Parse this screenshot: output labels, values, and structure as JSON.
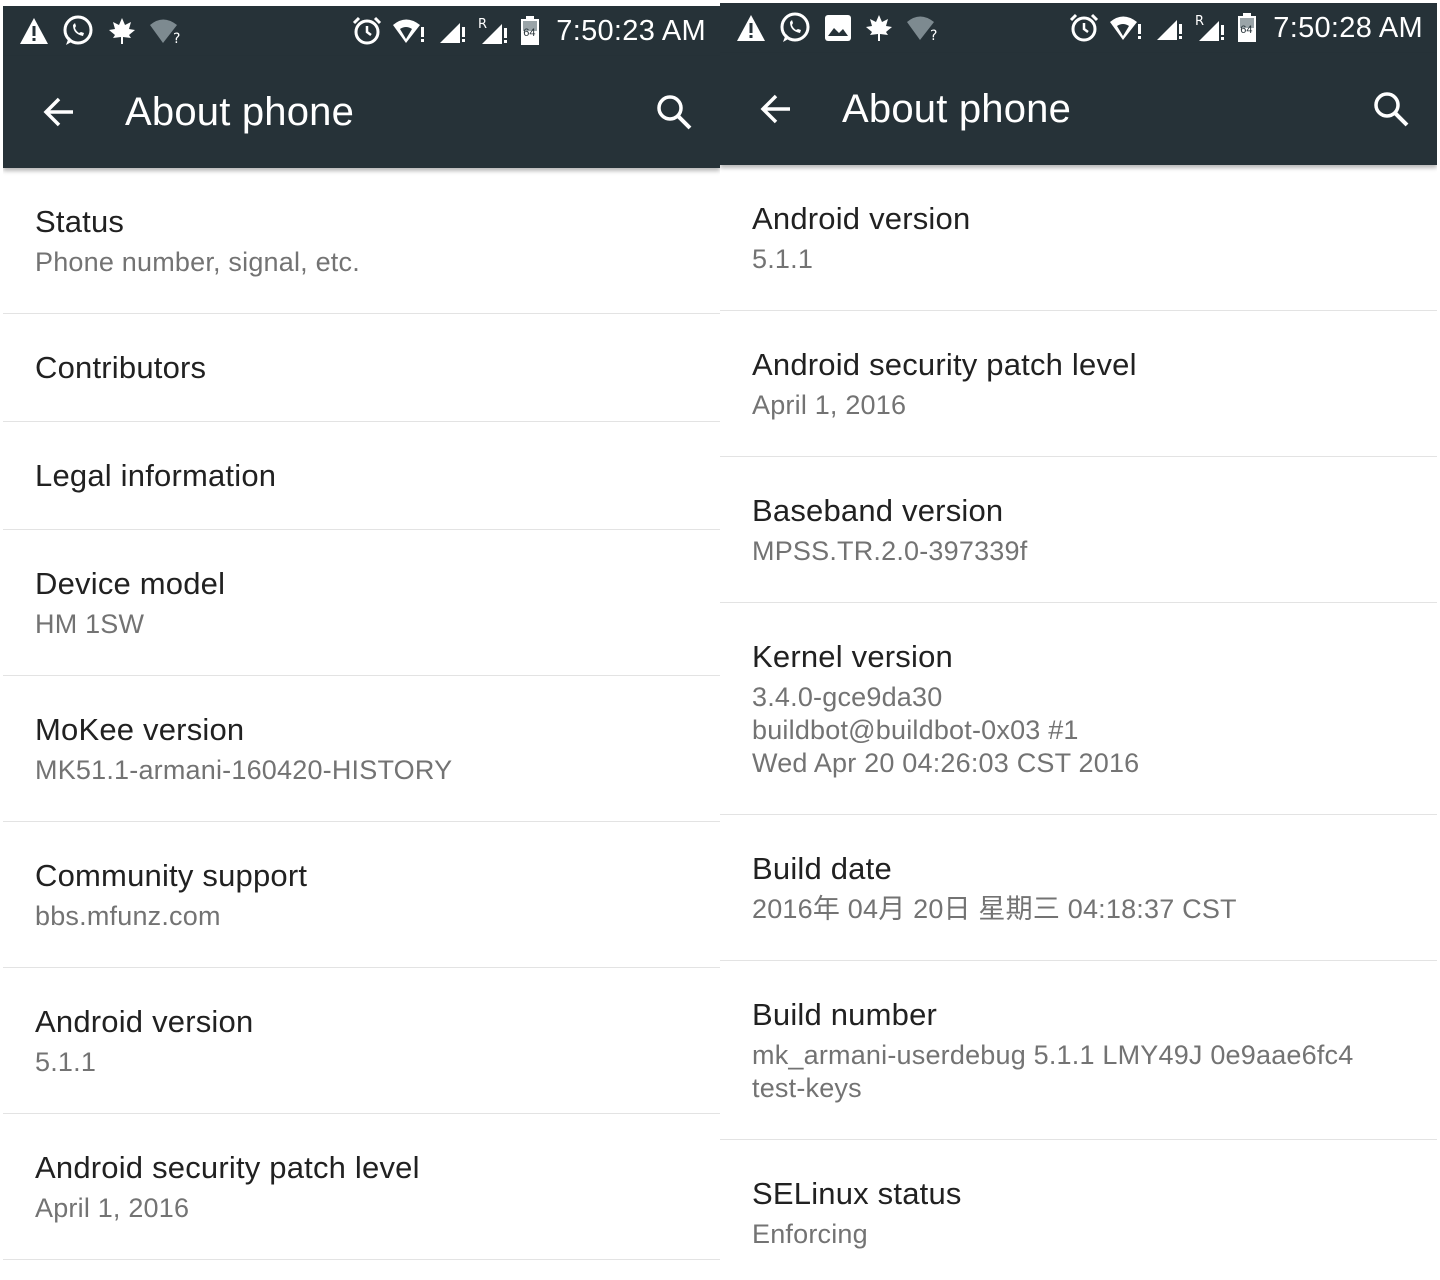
{
  "left": {
    "status_bar": {
      "time": "7:50:23 AM",
      "left_icons": [
        "warning-icon",
        "whatsapp-icon",
        "leaf-icon",
        "wifi-unknown-icon"
      ],
      "right_icons": [
        "alarm-icon",
        "wifi-alert-icon",
        "signal-icon",
        "signal-roaming-icon",
        "battery-icon"
      ],
      "battery_label": "64"
    },
    "app_bar": {
      "title": "About phone"
    },
    "items": [
      {
        "title": "Status",
        "summary": "Phone number, signal, etc."
      },
      {
        "title": "Contributors"
      },
      {
        "title": "Legal information"
      },
      {
        "title": "Device model",
        "summary": "HM 1SW"
      },
      {
        "title": "MoKee version",
        "summary": "MK51.1-armani-160420-HISTORY"
      },
      {
        "title": "Community support",
        "summary": "bbs.mfunz.com"
      },
      {
        "title": "Android version",
        "summary": "5.1.1"
      },
      {
        "title": "Android security patch level",
        "summary": "April 1, 2016"
      }
    ]
  },
  "right": {
    "status_bar": {
      "time": "7:50:28 AM",
      "left_icons": [
        "warning-icon",
        "whatsapp-icon",
        "image-icon",
        "leaf-icon",
        "wifi-unknown-icon"
      ],
      "right_icons": [
        "alarm-icon",
        "wifi-alert-icon",
        "signal-icon",
        "signal-roaming-icon",
        "battery-icon"
      ],
      "battery_label": "64"
    },
    "app_bar": {
      "title": "About phone"
    },
    "items": [
      {
        "title": "Android version",
        "summary": "5.1.1"
      },
      {
        "title": "Android security patch level",
        "summary": "April 1, 2016"
      },
      {
        "title": "Baseband version",
        "summary": "MPSS.TR.2.0-397339f"
      },
      {
        "title": "Kernel version",
        "summary": "3.4.0-gce9da30\nbuildbot@buildbot-0x03 #1\nWed Apr 20 04:26:03 CST 2016"
      },
      {
        "title": "Build date",
        "summary": "2016年 04月 20日 星期三 04:18:37 CST"
      },
      {
        "title": "Build number",
        "summary": "mk_armani-userdebug 5.1.1 LMY49J 0e9aae6fc4\ntest-keys"
      },
      {
        "title": "SELinux status",
        "summary": "Enforcing"
      }
    ]
  },
  "colors": {
    "toolbar": "#263238",
    "title_text": "#212121",
    "summary_text": "#737373",
    "divider": "#e3e3e3"
  }
}
